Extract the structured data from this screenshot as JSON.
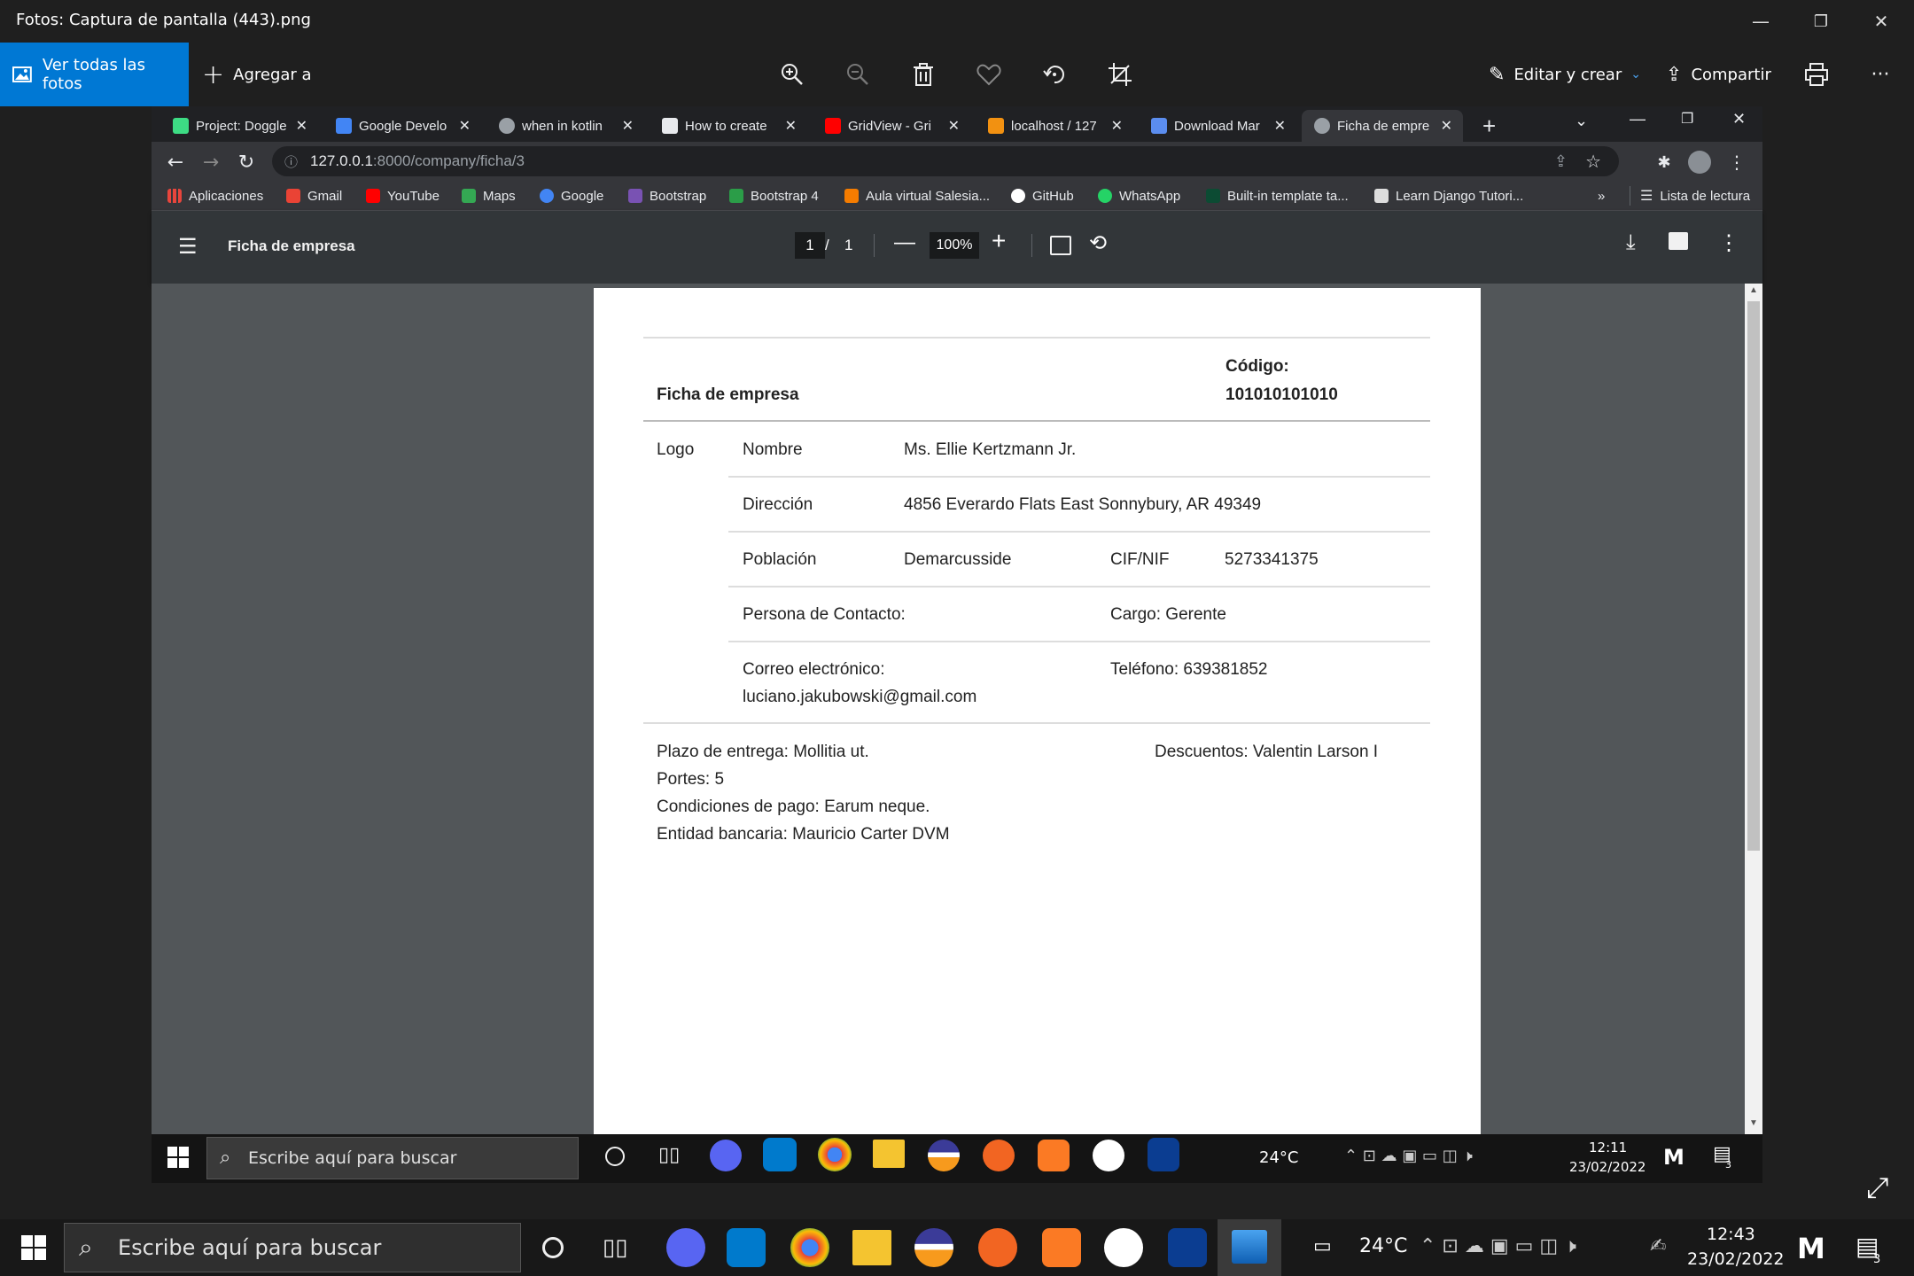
{
  "window": {
    "title": "Fotos: Captura de pantalla (443).png",
    "minimize": "—",
    "restore": "❐",
    "close": "✕"
  },
  "photos_toolbar": {
    "all_photos": "Ver todas las fotos",
    "add_to": "Agregar a",
    "edit_create": "Editar y crear",
    "share": "Compartir",
    "more": "···"
  },
  "browser": {
    "tabs": [
      {
        "label": "Project: Doggle",
        "color": "#3ddc84"
      },
      {
        "label": "Google Develo",
        "color": "#4285f4"
      },
      {
        "label": "when in kotlin",
        "color": "#9aa0a6"
      },
      {
        "label": "How to create",
        "color": "#e8eaed"
      },
      {
        "label": "GridView - Gri",
        "color": "#ff0000"
      },
      {
        "label": "localhost / 127",
        "color": "#f29111"
      },
      {
        "label": "Download Mar",
        "color": "#5b8def"
      },
      {
        "label": "Ficha de empre",
        "color": "#9aa0a6"
      }
    ],
    "new_tab": "+",
    "url_host": "127.0.0.1",
    "url_path": ":8000/company/ficha/3",
    "bookmarks": [
      {
        "label": "Aplicaciones",
        "color": "#e8453c"
      },
      {
        "label": "Gmail",
        "color": "#ea4335"
      },
      {
        "label": "YouTube",
        "color": "#ff0000"
      },
      {
        "label": "Maps",
        "color": "#34a853"
      },
      {
        "label": "Google",
        "color": "#4285f4"
      },
      {
        "label": "Bootstrap",
        "color": "#7952b3"
      },
      {
        "label": "Bootstrap 4",
        "color": "#2b9d48"
      },
      {
        "label": "Aula virtual Salesia...",
        "color": "#f57c00"
      },
      {
        "label": "GitHub",
        "color": "#ffffff"
      },
      {
        "label": "WhatsApp",
        "color": "#25d366"
      },
      {
        "label": "Built-in template ta...",
        "color": "#0c4b33"
      },
      {
        "label": "Learn Django Tutori...",
        "color": "#dddddd"
      }
    ],
    "more_bookmarks": "»",
    "reading_list": "Lista de lectura"
  },
  "pdf": {
    "title": "Ficha de empresa",
    "page_current": "1",
    "page_sep": "/",
    "page_total": "1",
    "zoom": "100%"
  },
  "document": {
    "heading": "Ficha de empresa",
    "code_label": "Código:",
    "code_value": "101010101010",
    "logo": "Logo",
    "name_label": "Nombre",
    "name_value": "Ms. Ellie Kertzmann Jr.",
    "address_label": "Dirección",
    "address_value": "4856 Everardo Flats East Sonnybury, AR 49349",
    "town_label": "Población",
    "town_value": "Demarcusside",
    "cif_label": "CIF/NIF",
    "cif_value": "5273341375",
    "contact_label": "Persona de Contacto:",
    "role": "Cargo: Gerente",
    "email_label": "Correo electrónico:",
    "email_value": "luciano.jakubowski@gmail.com",
    "phone": "Teléfono: 639381852",
    "delivery": "Plazo de entrega: Mollitia ut.",
    "discounts": "Descuentos: Valentin Larson I",
    "shipping": "Portes: 5",
    "payment": "Condiciones de pago: Earum neque.",
    "bank": "Entidad bancaria: Mauricio Carter DVM"
  },
  "inner_taskbar": {
    "search_placeholder": "Escribe aquí para buscar",
    "temp": "24°C",
    "time": "12:11",
    "date": "23/02/2022",
    "notif_count": "3"
  },
  "taskbar": {
    "search_placeholder": "Escribe aquí para buscar",
    "temp": "24°C",
    "time": "12:43",
    "date": "23/02/2022",
    "notif_count": "3"
  }
}
